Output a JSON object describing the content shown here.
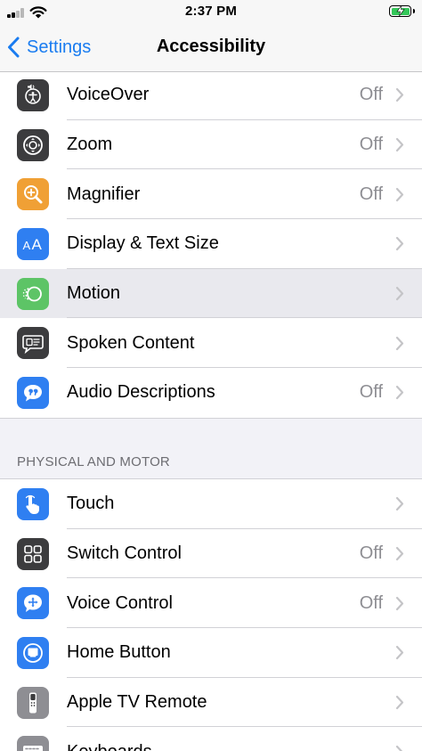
{
  "status_bar": {
    "time": "2:37 PM"
  },
  "nav": {
    "back_label": "Settings",
    "title": "Accessibility"
  },
  "colors": {
    "accent": "#1a7cf0",
    "icon_gray": "#3c3c3e",
    "icon_blue": "#2f7ff1",
    "icon_orange": "#f0a035",
    "icon_green": "#5dc466",
    "battery_green": "#34c759"
  },
  "vision_rows": [
    {
      "label": "VoiceOver",
      "value": "Off",
      "icon": "voiceover-icon"
    },
    {
      "label": "Zoom",
      "value": "Off",
      "icon": "zoom-icon"
    },
    {
      "label": "Magnifier",
      "value": "Off",
      "icon": "magnifier-icon"
    },
    {
      "label": "Display & Text Size",
      "value": "",
      "icon": "display-text-size-icon"
    },
    {
      "label": "Motion",
      "value": "",
      "icon": "motion-icon"
    },
    {
      "label": "Spoken Content",
      "value": "",
      "icon": "spoken-content-icon"
    },
    {
      "label": "Audio Descriptions",
      "value": "Off",
      "icon": "audio-descriptions-icon"
    }
  ],
  "physical_section": {
    "header": "PHYSICAL AND MOTOR"
  },
  "physical_rows": [
    {
      "label": "Touch",
      "value": "",
      "icon": "touch-icon"
    },
    {
      "label": "Switch Control",
      "value": "Off",
      "icon": "switch-control-icon"
    },
    {
      "label": "Voice Control",
      "value": "Off",
      "icon": "voice-control-icon"
    },
    {
      "label": "Home Button",
      "value": "",
      "icon": "home-button-icon"
    },
    {
      "label": "Apple TV Remote",
      "value": "",
      "icon": "apple-tv-remote-icon"
    },
    {
      "label": "Keyboards",
      "value": "",
      "icon": "keyboards-icon"
    }
  ]
}
